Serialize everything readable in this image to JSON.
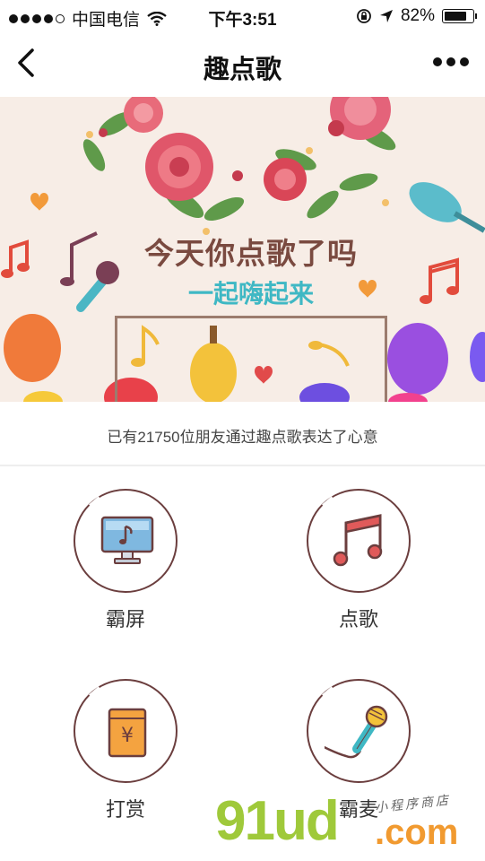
{
  "status_bar": {
    "carrier": "中国电信",
    "time": "下午3:51",
    "battery": "82%",
    "battery_level": 0.82
  },
  "nav": {
    "title": "趣点歌"
  },
  "banner": {
    "headline": "今天你点歌了吗",
    "subline": "一起嗨起来"
  },
  "stat_text": "已有21750位朋友通过趣点歌表达了心意",
  "grid": [
    {
      "label": "霸屏",
      "icon": "monitor-music-icon"
    },
    {
      "label": "点歌",
      "icon": "music-note-icon"
    },
    {
      "label": "打赏",
      "icon": "red-envelope-yen-icon"
    },
    {
      "label": "霸麦",
      "icon": "microphone-icon"
    }
  ],
  "watermark": {
    "brand": "91ud",
    "suffix": ".com",
    "tagline": "小程序商店"
  },
  "colors": {
    "accent_circle": "#6b3e3e",
    "banner_headline": "#7a4a40",
    "banner_sub": "#3fb8c4"
  }
}
